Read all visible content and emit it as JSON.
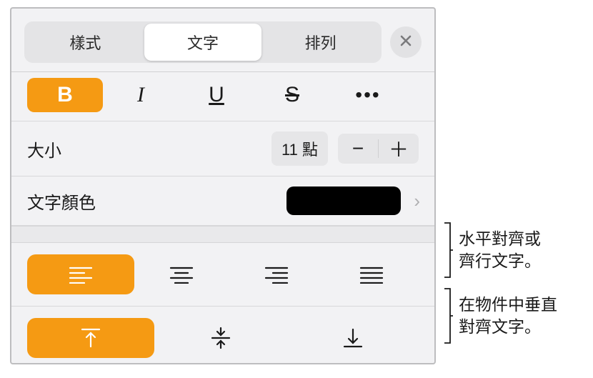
{
  "tabs": {
    "style": "樣式",
    "text": "文字",
    "arrange": "排列",
    "active": "text"
  },
  "styleRow": {
    "bold_active": true
  },
  "size": {
    "label": "大小",
    "value": "11 點"
  },
  "color": {
    "label": "文字顏色",
    "swatch": "#000000"
  },
  "alignH": {
    "active": "left"
  },
  "alignV": {
    "active": "top"
  },
  "callouts": {
    "horizontal": "水平對齊或\n齊行文字。",
    "vertical": "在物件中垂直\n對齊文字。"
  }
}
